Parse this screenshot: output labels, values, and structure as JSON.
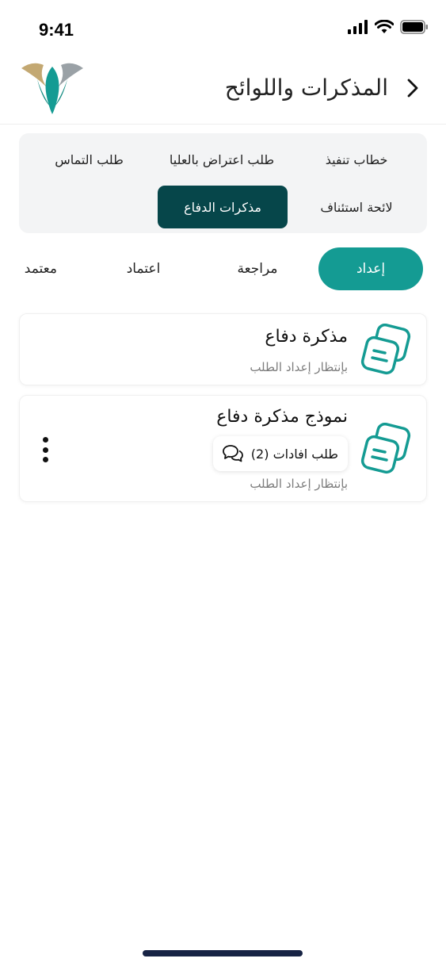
{
  "status_bar": {
    "time": "9:41"
  },
  "header": {
    "title": "المذكرات واللوائح"
  },
  "categories": [
    {
      "label": "خطاب تنفيذ",
      "active": false
    },
    {
      "label": "طلب اعتراض بالعليا",
      "active": false
    },
    {
      "label": "طلب التماس",
      "active": false
    },
    {
      "label": "لائحة استئناف",
      "active": false
    },
    {
      "label": "مذكرات الدفاع",
      "active": true
    }
  ],
  "status_tabs": [
    {
      "label": "إعداد",
      "active": true
    },
    {
      "label": "مراجعة",
      "active": false
    },
    {
      "label": "اعتماد",
      "active": false
    },
    {
      "label": "معتمد",
      "active": false
    }
  ],
  "cards": [
    {
      "title": "مذكرة دفاع",
      "status": "بإنتظار إعداد الطلب",
      "icon": "document-icon"
    },
    {
      "title": "نموذج مذكرة دفاع",
      "status": "بإنتظار إعداد الطلب",
      "icon": "document-icon",
      "chip_label": "طلب افادات (2)"
    }
  ],
  "colors": {
    "primary": "#149b93",
    "dark": "#06464a",
    "panel": "#f3f4f5"
  }
}
